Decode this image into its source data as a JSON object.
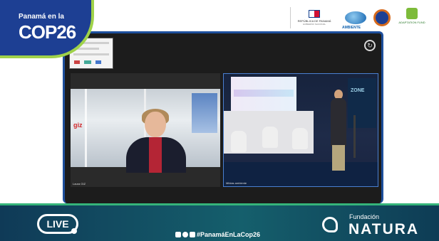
{
  "header": {
    "badge_subtitle": "Panamá en la",
    "badge_title": "COP26",
    "gov_line1": "REPÚBLICA DE PANAMÁ",
    "gov_line2": "GOBIERNO NACIONAL",
    "ambiente_label": "AMBIENTE",
    "adaptation_label": "ADAPTATION FUND"
  },
  "meeting": {
    "left_tile_label": "Laura GIZ",
    "right_tile_label": "Mildas ambiente",
    "right_banner_text": "ZONE"
  },
  "scene": {
    "left_logo": "giz"
  },
  "footer": {
    "live_label": "LIVE",
    "hashtag": "#PanamáEnLaCop26",
    "org_prefix": "Fundación",
    "org_name": "NATURA"
  },
  "colors": {
    "cop_blue": "#1d3f93",
    "cop_green": "#9fd24a",
    "banner_teal": "#155f6c",
    "frame_blue": "#1d4f9c"
  }
}
